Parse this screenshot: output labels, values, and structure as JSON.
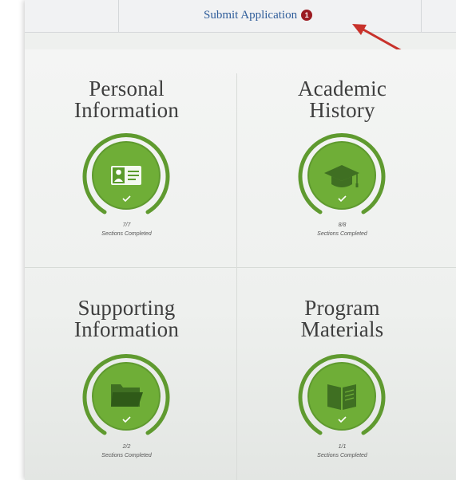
{
  "topbar": {
    "submit_label": "Submit Application",
    "badge_count": "1"
  },
  "tiles": [
    {
      "title_line1": "Personal",
      "title_line2": "Information",
      "count": "7/7",
      "status": "Sections Completed",
      "icon": "id-card-icon"
    },
    {
      "title_line1": "Academic",
      "title_line2": "History",
      "count": "8/8",
      "status": "Sections Completed",
      "icon": "graduation-cap-icon"
    },
    {
      "title_line1": "Supporting",
      "title_line2": "Information",
      "count": "2/2",
      "status": "Sections Completed",
      "icon": "folder-icon"
    },
    {
      "title_line1": "Program",
      "title_line2": "Materials",
      "count": "1/1",
      "status": "Sections Completed",
      "icon": "book-icon"
    }
  ],
  "colors": {
    "ring_green": "#5f9a2f",
    "inner_green": "#73b13a",
    "icon_green": "#5a9b2b",
    "badge_red": "#9b1b21",
    "link_blue": "#2f5d9a",
    "arrow_red": "#c8322b"
  }
}
